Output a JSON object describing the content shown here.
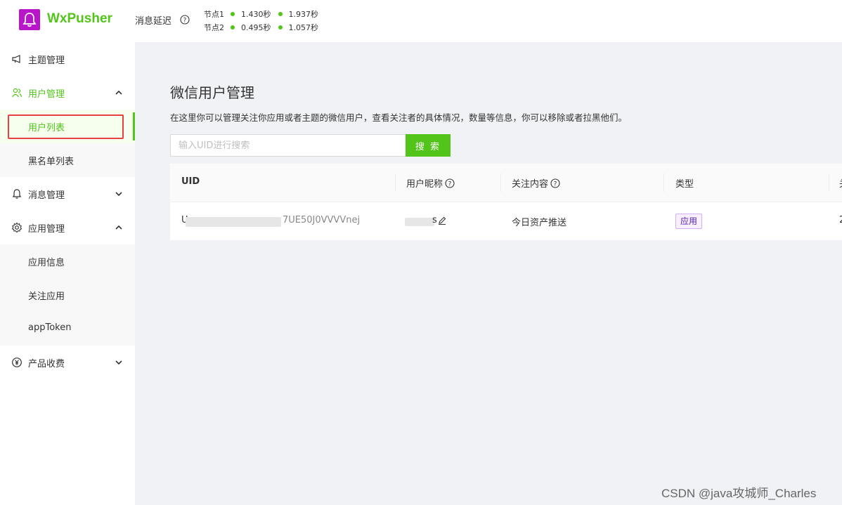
{
  "header": {
    "logo_text": "WxPusher",
    "delay_label": "消息延迟",
    "nodes": [
      {
        "name": "节点1",
        "t1": "1.430秒",
        "t2": "1.937秒"
      },
      {
        "name": "节点2",
        "t1": "0.495秒",
        "t2": "1.057秒"
      }
    ],
    "status_color": "#52c41a",
    "logo_color": "#b915c9"
  },
  "sidebar": {
    "topic_mgmt": "主题管理",
    "user_mgmt": "用户管理",
    "user_list": "用户列表",
    "blacklist": "黑名单列表",
    "msg_mgmt": "消息管理",
    "app_mgmt": "应用管理",
    "app_info": "应用信息",
    "follow_app": "关注应用",
    "app_token": "appToken",
    "billing": "产品收费"
  },
  "main": {
    "title": "微信用户管理",
    "description": "在这里你可以管理关注你应用或者主题的微信用户，查看关注者的具体情况，数量等信息，你可以移除或者拉黑他们。",
    "search_placeholder": "输入UID进行搜索",
    "search_button": "搜 索",
    "table": {
      "headers": [
        "UID",
        "用户昵称",
        "关注内容",
        "类型",
        "关"
      ],
      "rows": [
        {
          "uid_start": "U",
          "uid_end": "7UE50J0VVVVnej",
          "nickname_end": "s",
          "content": "今日资产推送",
          "type": "应用",
          "extra": "2"
        }
      ]
    }
  },
  "watermark": "CSDN @java攻城师_Charles",
  "accent_color": "#52c41a"
}
